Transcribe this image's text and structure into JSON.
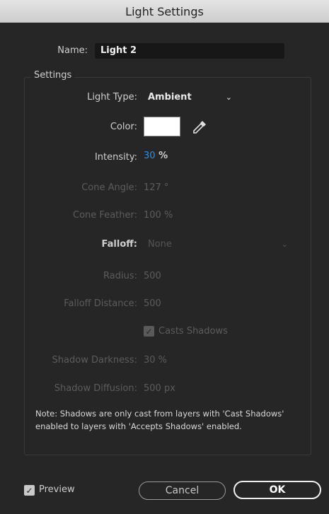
{
  "window": {
    "title": "Light Settings"
  },
  "name": {
    "label": "Name:",
    "value": "Light 2"
  },
  "settings": {
    "title": "Settings",
    "light_type": {
      "label": "Light Type:",
      "value": "Ambient",
      "icon": "chevron-down-icon"
    },
    "color": {
      "label": "Color:",
      "swatch": "#ffffff",
      "icon": "eyedropper-icon"
    },
    "intensity": {
      "label": "Intensity:",
      "value": "30",
      "unit": "%"
    },
    "cone_angle": {
      "label": "Cone Angle:",
      "value": "127 °"
    },
    "cone_feather": {
      "label": "Cone Feather:",
      "value": "100 %"
    },
    "falloff": {
      "label": "Falloff:",
      "value": "None",
      "icon": "chevron-down-icon"
    },
    "radius": {
      "label": "Radius:",
      "value": "500"
    },
    "falloff_distance": {
      "label": "Falloff Distance:",
      "value": "500"
    },
    "casts_shadows": {
      "label": "Casts Shadows",
      "checked": true
    },
    "shadow_darkness": {
      "label": "Shadow Darkness:",
      "value": "30 %"
    },
    "shadow_diffusion": {
      "label": "Shadow Diffusion:",
      "value": "500 px"
    },
    "note": "Note: Shadows are only cast from layers with 'Cast Shadows' enabled to layers with 'Accepts Shadows' enabled."
  },
  "footer": {
    "preview_label": "Preview",
    "preview_checked": true,
    "cancel_label": "Cancel",
    "ok_label": "OK"
  },
  "colors": {
    "accent": "#2f8ee8",
    "background": "#262626",
    "field": "#171717"
  }
}
